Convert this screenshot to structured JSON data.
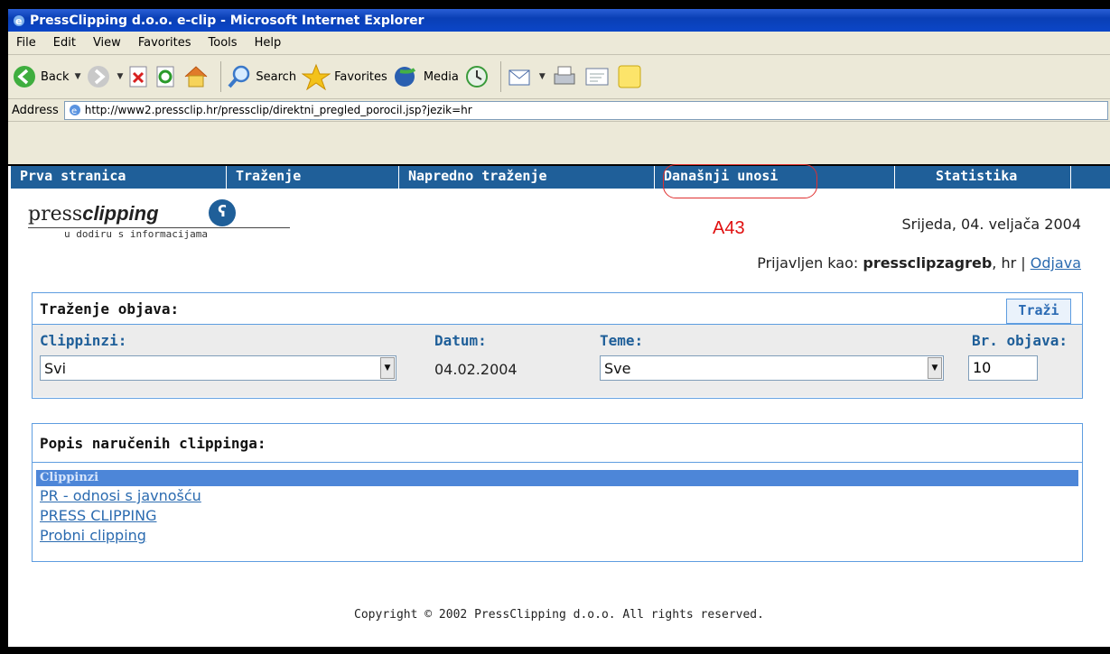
{
  "window": {
    "title": "PressClipping d.o.o. e-clip - Microsoft Internet Explorer"
  },
  "menu": [
    "File",
    "Edit",
    "View",
    "Favorites",
    "Tools",
    "Help"
  ],
  "toolbar": {
    "back": "Back",
    "search": "Search",
    "favorites": "Favorites",
    "media": "Media"
  },
  "address": {
    "label": "Address",
    "url": "http://www2.pressclip.hr/pressclip/direktni_pregled_porocil.jsp?jezik=hr"
  },
  "nav": [
    "Prva stranica",
    "Traženje",
    "Napredno traženje",
    "Današnji unosi",
    "Statistika"
  ],
  "logo": {
    "press": "press",
    "clipping": "clipping",
    "tagline": "u dodiru s informacijama"
  },
  "annotation": "A43",
  "date": "Srijeda, 04. veljača 2004",
  "login": {
    "prefix": "Prijavljen kao: ",
    "user": "pressclipzagreb",
    "lang": ", hr | ",
    "logout": "Odjava"
  },
  "search": {
    "title": "Traženje objava:",
    "button": "Traži",
    "clippinzi_label": "Clippinzi:",
    "clippinzi_value": "Svi",
    "datum_label": "Datum:",
    "datum_value": "04.02.2004",
    "teme_label": "Teme:",
    "teme_value": "Sve",
    "br_label": "Br. objava:",
    "br_value": "10"
  },
  "list": {
    "title": "Popis naručenih clippinga:",
    "header": "Clippinzi",
    "items": [
      "PR - odnosi s javnošću",
      "PRESS CLIPPING",
      "Probni clipping"
    ]
  },
  "copyright": "Copyright © 2002 PressClipping d.o.o. All rights reserved.",
  "colors": {
    "nav": "#1f5f99",
    "accent": "#5e9de0",
    "annotation": "#e01010"
  }
}
